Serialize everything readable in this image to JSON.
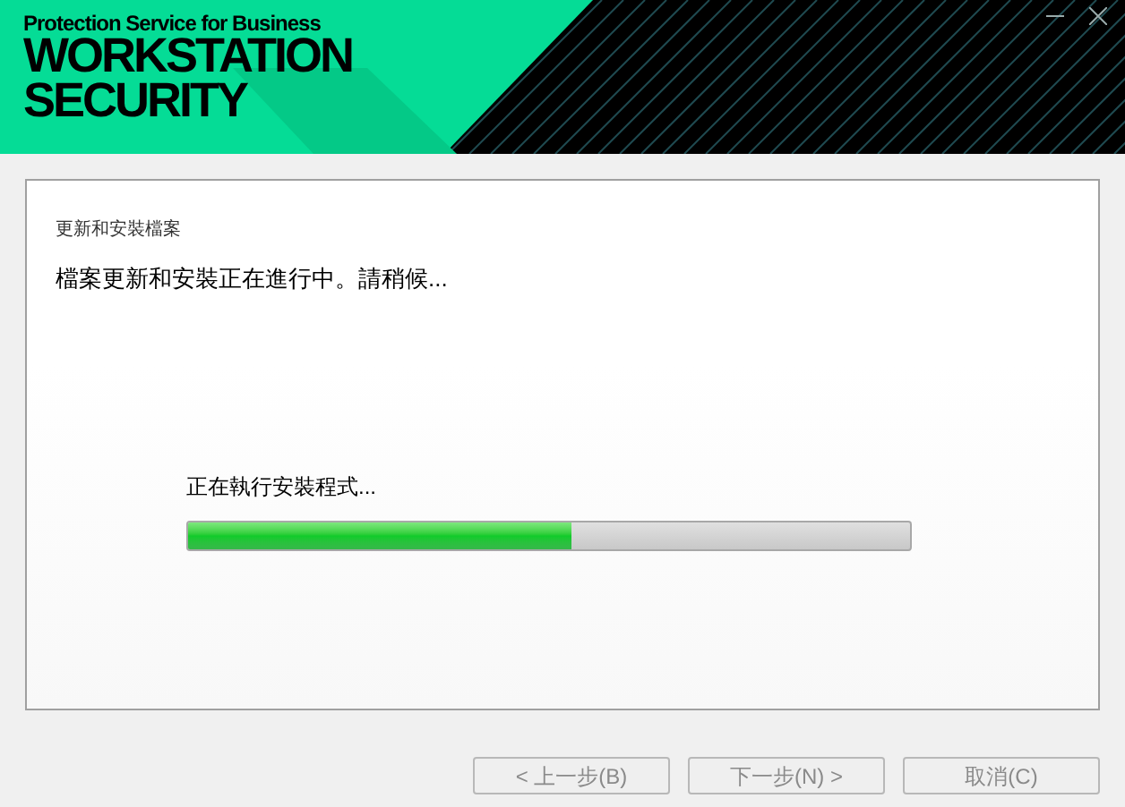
{
  "header": {
    "subtitle": "Protection Service for Business",
    "title_lines": [
      "WORKSTATION",
      "SECURITY"
    ]
  },
  "window_controls": [
    {
      "kind": "minimize"
    },
    {
      "kind": "close"
    }
  ],
  "panel": {
    "heading": "更新和安裝檔案",
    "message": "檔案更新和安裝正在進行中。請稍候...",
    "status": "正在執行安裝程式...",
    "progress": {
      "level": 0.53
    }
  },
  "buttons": [
    {
      "label": "< 上一步(B)",
      "disabled": true
    },
    {
      "label": "下一步(N) >",
      "disabled": true
    },
    {
      "label": "取消(C)",
      "disabled": true
    }
  ]
}
